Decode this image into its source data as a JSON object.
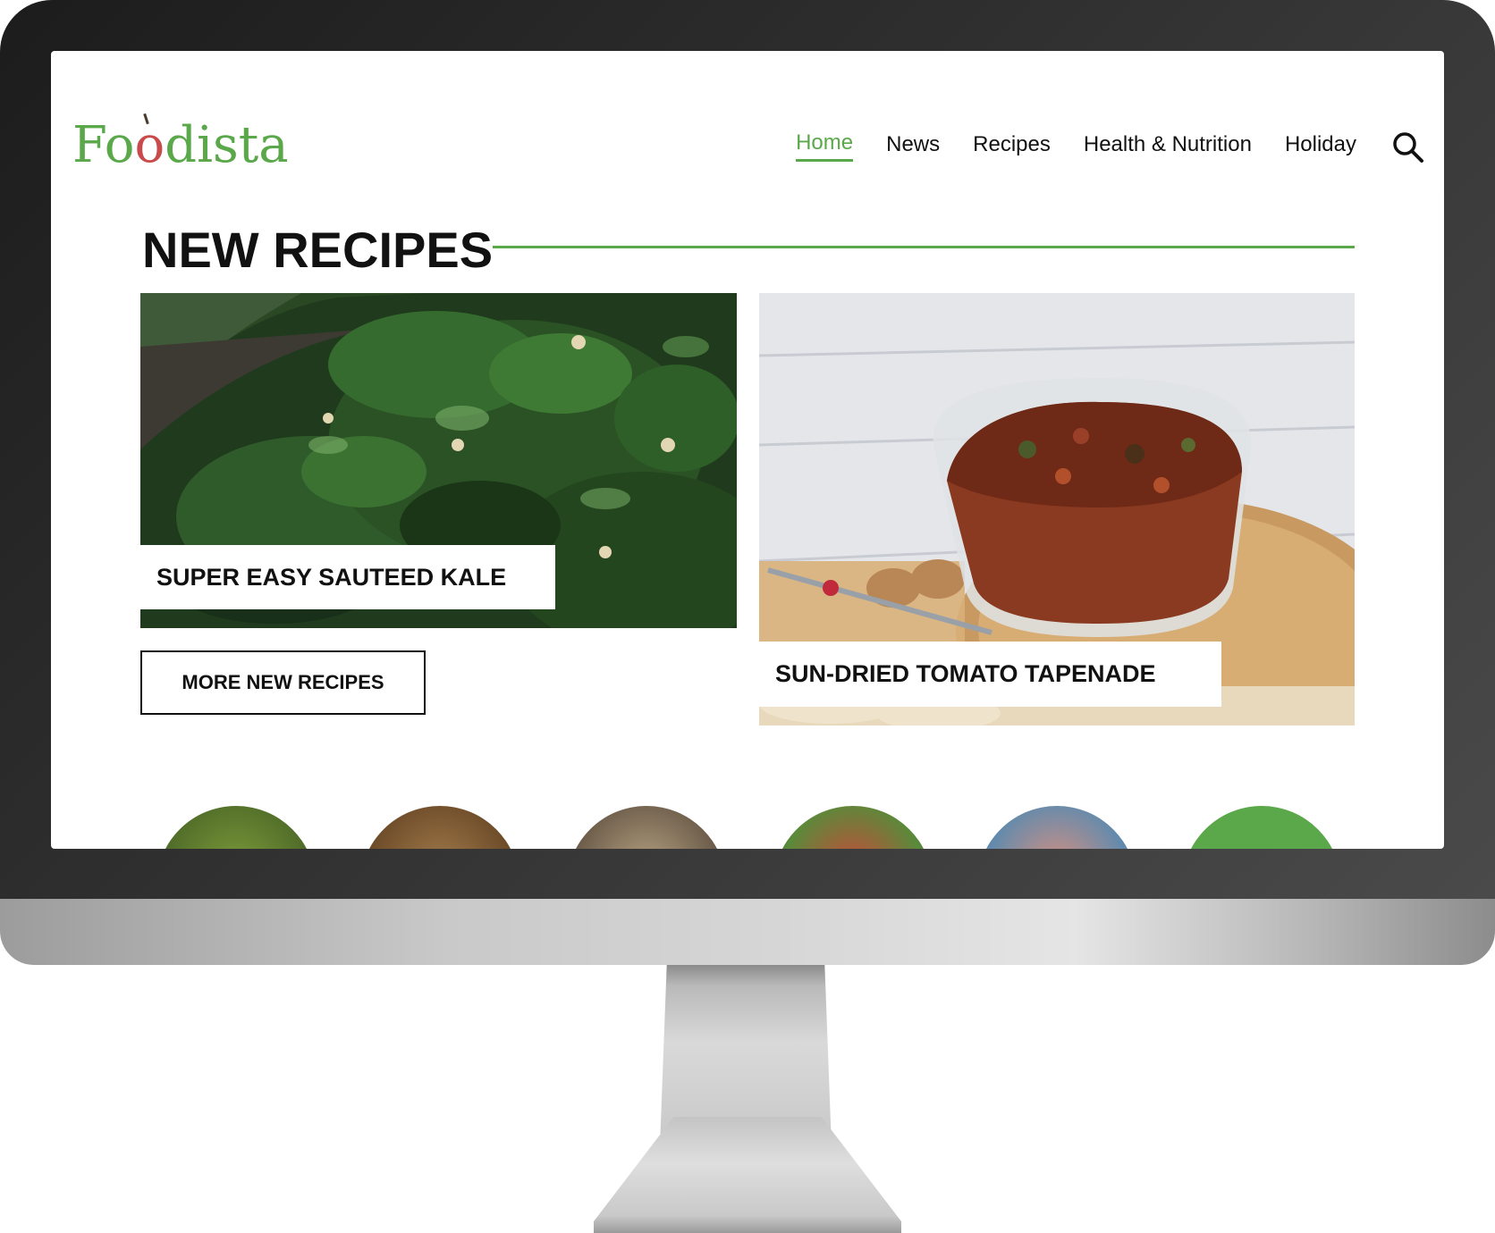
{
  "brand": {
    "logo_text_a": "Fo",
    "logo_text_b": "o",
    "logo_text_c": "dista",
    "accent_color": "#5aa84a"
  },
  "nav": {
    "items": [
      {
        "label": "Home",
        "active": true
      },
      {
        "label": "News",
        "active": false
      },
      {
        "label": "Recipes",
        "active": false
      },
      {
        "label": "Health & Nutrition",
        "active": false
      },
      {
        "label": "Holiday",
        "active": false
      }
    ],
    "search_icon": "search-icon"
  },
  "section": {
    "title": "NEW RECIPES"
  },
  "cards": [
    {
      "title": "SUPER EASY SAUTEED KALE",
      "image": "sauteed-kale-photo"
    },
    {
      "title": "SUN-DRIED TOMATO TAPENADE",
      "image": "sun-dried-tomato-tapenade-photo"
    }
  ],
  "more_button": {
    "label": "MORE NEW RECIPES"
  },
  "thumbnails": [
    {
      "image": "greens-thumb"
    },
    {
      "image": "roast-chicken-thumb"
    },
    {
      "image": "grain-salad-thumb"
    },
    {
      "image": "tomato-salad-thumb"
    },
    {
      "image": "citrus-tart-thumb"
    },
    {
      "image": "green-circle-thumb"
    }
  ]
}
